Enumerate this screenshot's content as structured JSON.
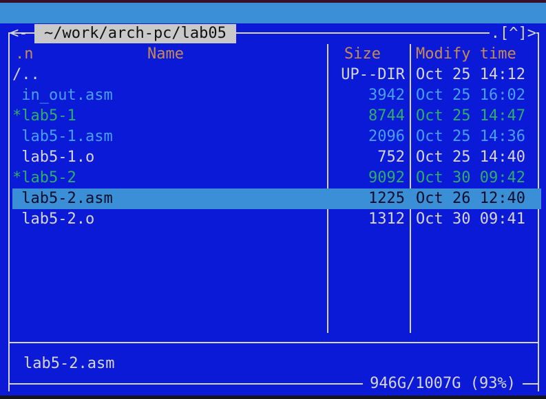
{
  "colors": {
    "panel_bg": "#0a1ad6",
    "header_text": "#c98a56",
    "default_text": "#d6d6d6",
    "source_file": "#4aa0f0",
    "executable": "#2fae6a",
    "selected_bg": "#3b8fd6",
    "title_bg": "#c9c9c9"
  },
  "panel": {
    "path": "~/work/arch-pc/lab05",
    "left_corner": "<-",
    "right_corner": ".[^]>",
    "headers": {
      "sort": ".n",
      "name": "Name",
      "size": "Size",
      "time": "Modify time"
    },
    "files": [
      {
        "name": "/..",
        "size": "UP--DIR",
        "time": "Oct 25 14:12",
        "kind": "updir"
      },
      {
        "name": " in_out.asm",
        "size": "3942",
        "time": "Oct 25 16:02",
        "kind": "source"
      },
      {
        "name": "*lab5-1",
        "size": "8744",
        "time": "Oct 25 14:47",
        "kind": "exec"
      },
      {
        "name": " lab5-1.asm",
        "size": "2096",
        "time": "Oct 25 14:36",
        "kind": "source"
      },
      {
        "name": " lab5-1.o",
        "size": "752",
        "time": "Oct 25 14:40",
        "kind": "normal"
      },
      {
        "name": "*lab5-2",
        "size": "9092",
        "time": "Oct 30 09:42",
        "kind": "exec"
      },
      {
        "name": " lab5-2.asm",
        "size": "1225",
        "time": "Oct 26 12:40",
        "kind": "selected"
      },
      {
        "name": " lab5-2.o",
        "size": "1312",
        "time": "Oct 30 09:41",
        "kind": "normal"
      }
    ],
    "status_filename": "lab5-2.asm",
    "disk_usage": "946G/1007G (93%)"
  }
}
